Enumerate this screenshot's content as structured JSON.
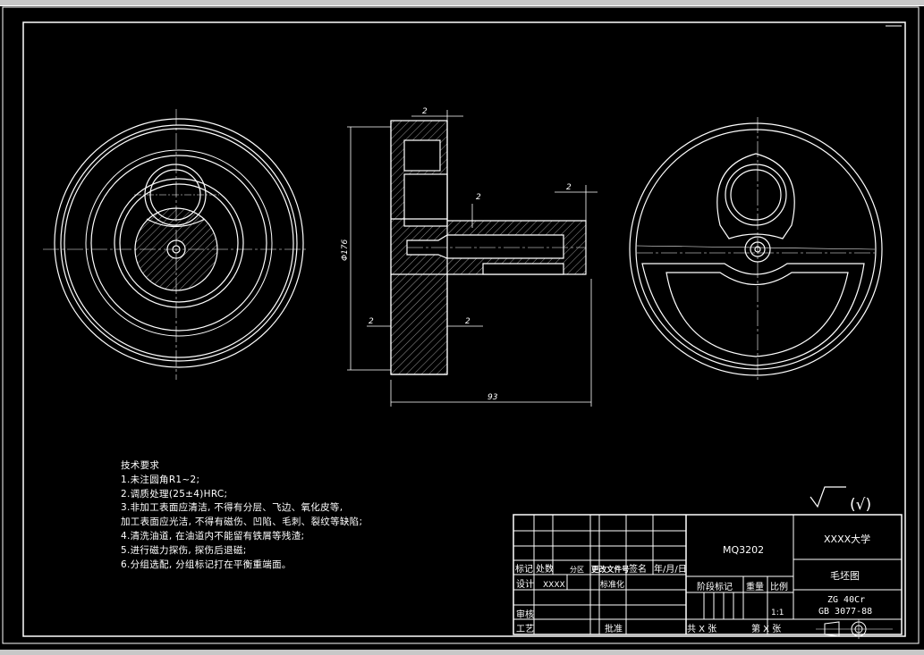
{
  "drawing": {
    "dimensions": {
      "top_left": "2",
      "right_top": "2",
      "inner": "2",
      "bottom_left": "2",
      "bottom_right": "2",
      "diameter": "Φ176",
      "length": "93"
    },
    "roughness": "(√)"
  },
  "tech_requirements": {
    "title": "技术要求",
    "items": [
      "1.未注圆角R1~2;",
      "2.调质处理(25±4)HRC;",
      "3.非加工表面应清洁, 不得有分层、飞边、氧化皮等,",
      "加工表面应光洁, 不得有磁伤、凹陷、毛刺、裂纹等缺陷;",
      "4.清洗油道, 在油道内不能留有铁屑等残渣;",
      "5.进行磁力探伤, 探伤后退磁;",
      "6.分组选配, 分组标记打在平衡重端面。"
    ]
  },
  "title_block": {
    "drawing_number": "MQ3202",
    "university": "XXXX大学",
    "drawing_name": "毛坯图",
    "material_1": "ZG 40Cr",
    "material_2": "GB 3077-88",
    "scale": "1:1",
    "labels": {
      "mark": "标记",
      "count": "处数",
      "zone": "分区",
      "change_doc": "更改文件号",
      "signature": "签名",
      "date": "年/月/日",
      "design": "设计",
      "designer": "XXXX",
      "standardize": "标准化",
      "stage": "阶段标记",
      "weight": "重量",
      "ratio": "比例",
      "review": "审核",
      "process": "工艺",
      "approve": "批准",
      "total_sheets": "共 X 张",
      "sheet_no": "第 X 张"
    }
  }
}
